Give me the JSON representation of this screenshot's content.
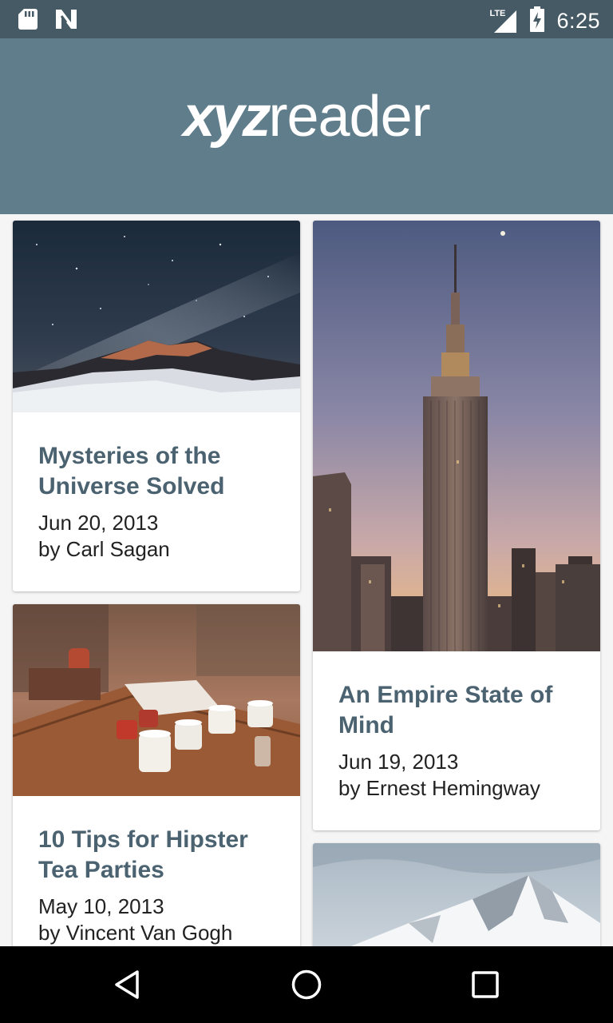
{
  "status_bar": {
    "time": "6:25",
    "network": "LTE",
    "icons": [
      "sd-card-icon",
      "n-notification-icon",
      "signal-icon",
      "battery-charging-icon"
    ]
  },
  "app_bar": {
    "logo_bold": "xyz",
    "logo_light": "reader"
  },
  "articles": [
    {
      "title": "Mysteries of the Universe Solved",
      "date": "Jun 20, 2013",
      "author": "by Carl Sagan",
      "image": "milky-way-over-mountains"
    },
    {
      "title": "An Empire State of Mind",
      "date": "Jun 19, 2013",
      "author": "by Ernest Hemingway",
      "image": "empire-state-building"
    },
    {
      "title": "10 Tips for Hipster Tea Parties",
      "date": "May 10, 2013",
      "author": "by Vincent Van Gogh",
      "image": "tea-cups-on-table"
    },
    {
      "title": "",
      "date": "",
      "author": "",
      "image": "snowy-mountain-peak"
    }
  ],
  "nav_bar": {
    "buttons": [
      "back-icon",
      "home-icon",
      "recents-icon"
    ]
  },
  "colors": {
    "status_bar": "#455a64",
    "app_bar": "#607d8b",
    "title_text": "#4b6270",
    "nav_bar": "#000000"
  }
}
